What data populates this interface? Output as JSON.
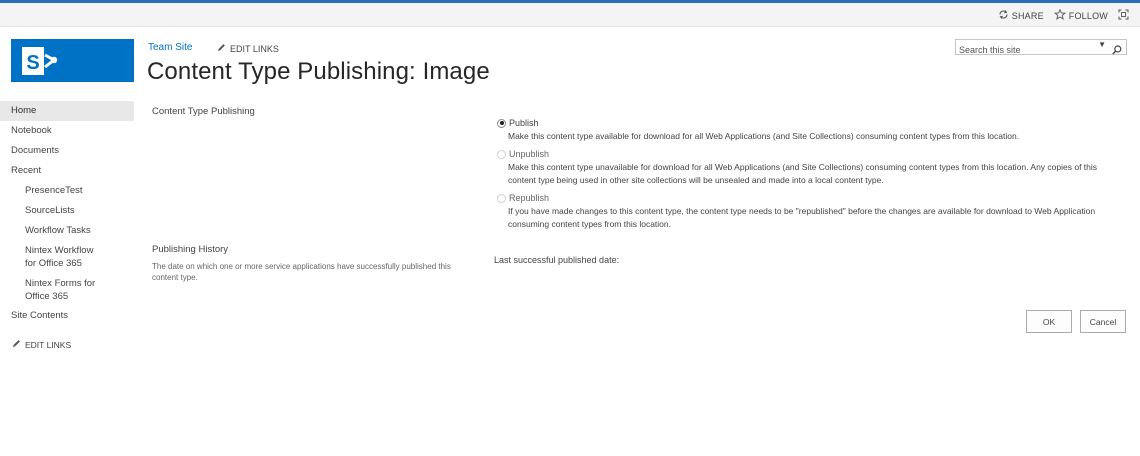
{
  "topbar": {
    "share_label": "SHARE",
    "follow_label": "FOLLOW"
  },
  "header": {
    "site_name": "Team Site",
    "edit_links_label": "EDIT LINKS",
    "page_title": "Content Type Publishing: Image"
  },
  "search": {
    "placeholder": "Search this site"
  },
  "nav": {
    "home": "Home",
    "notebook": "Notebook",
    "documents": "Documents",
    "recent": "Recent",
    "recent_items": [
      "PresenceTest",
      "SourceLists",
      "Workflow Tasks",
      "Nintex Workflow for Office 365",
      "Nintex Forms for Office 365"
    ],
    "site_contents": "Site Contents",
    "edit_links_label": "EDIT LINKS"
  },
  "content_type_publishing": {
    "section_label": "Content Type Publishing",
    "options": [
      {
        "label": "Publish",
        "description": "Make this content type available for download for all Web Applications (and Site Collections) consuming content types from this location."
      },
      {
        "label": "Unpublish",
        "description": "Make this content type unavailable for download for all Web Applications (and Site Collections) consuming content types from this location. Any copies of this content type being used in other site collections will be unsealed and made into a local content type."
      },
      {
        "label": "Republish",
        "description": "If you have made changes to this content type, the content type needs to be \"republished\" before the changes are available for download to Web Application consuming content types from this location."
      }
    ]
  },
  "publishing_history": {
    "section_label": "Publishing History",
    "description": "The date on which one or more service applications have successfully published this content type.",
    "last_published_label": "Last successful published date:"
  },
  "buttons": {
    "ok": "OK",
    "cancel": "Cancel"
  },
  "colors": {
    "accent": "#0072c6",
    "top_border": "#2a6ebb"
  }
}
